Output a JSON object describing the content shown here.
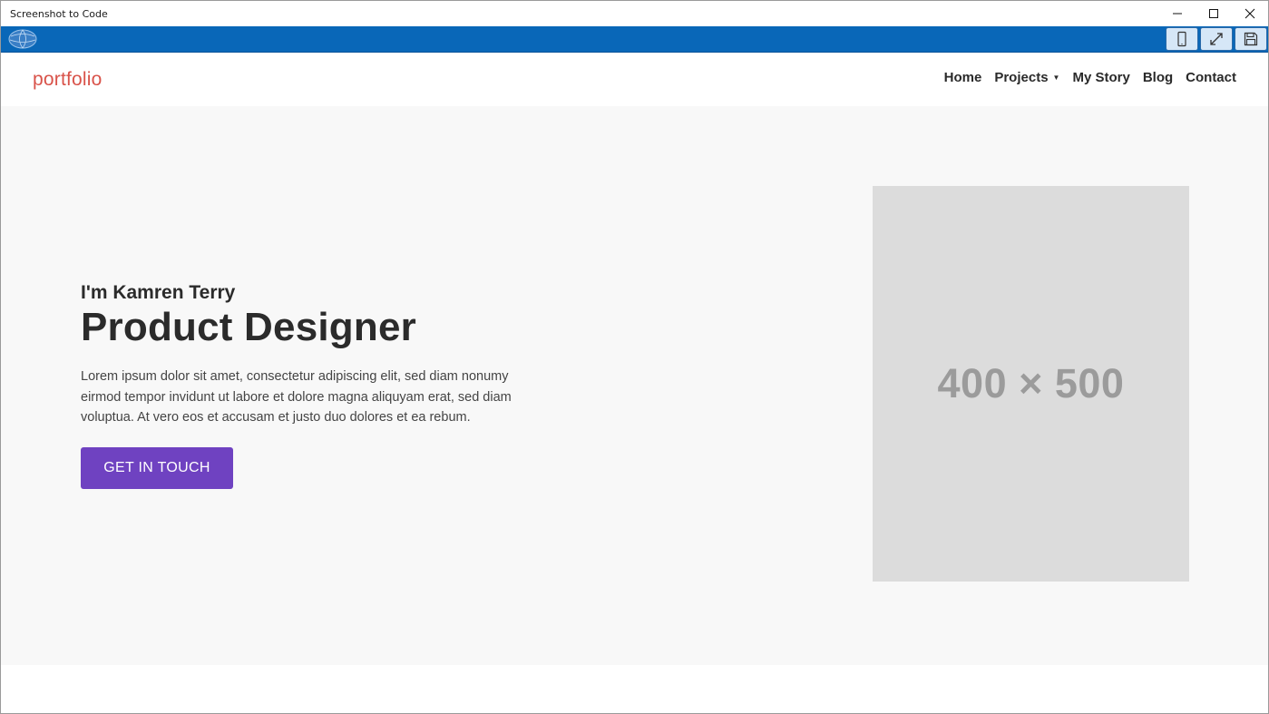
{
  "window": {
    "title": "Screenshot to Code",
    "controls": [
      "minimize-icon",
      "maximize-icon",
      "close-icon"
    ]
  },
  "toolbar": {
    "logo_icon": "globe-logo-icon",
    "buttons": [
      {
        "icon": "mobile-device-icon"
      },
      {
        "icon": "expand-arrows-icon"
      },
      {
        "icon": "save-disk-icon"
      }
    ],
    "color": "#0967b8"
  },
  "site": {
    "brand": "portfolio",
    "brand_color": "#d9534a",
    "nav": {
      "home": "Home",
      "projects": "Projects",
      "projects_caret": "▼",
      "my_story": "My Story",
      "blog": "Blog",
      "contact": "Contact"
    }
  },
  "hero": {
    "intro": "I'm Kamren Terry",
    "headline": "Product Designer",
    "description": "Lorem ipsum dolor sit amet, consectetur adipiscing elit, sed diam nonumy eirmod tempor invidunt ut labore et dolore magna aliquyam erat, sed diam voluptua. At vero eos et accusam et justo duo dolores et ea rebum.",
    "cta_label": "GET IN TOUCH",
    "cta_color": "#6f42c1",
    "image_placeholder": "400 × 500"
  }
}
